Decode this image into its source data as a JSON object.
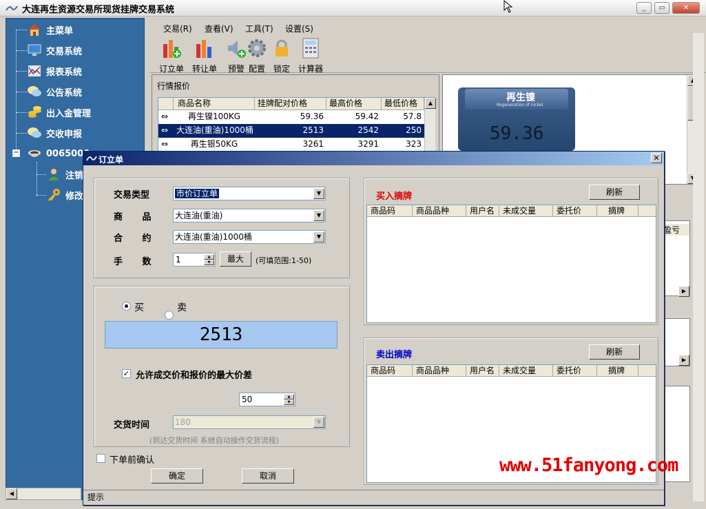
{
  "window": {
    "title": "大连再生资源交易所现货挂牌交易系统"
  },
  "sidebar": {
    "items": [
      {
        "label": "主菜单",
        "icon": "home-icon"
      },
      {
        "label": "交易系统",
        "icon": "monitor-icon"
      },
      {
        "label": "报表系统",
        "icon": "chart-report-icon"
      },
      {
        "label": "公告系统",
        "icon": "speech-bubble-icon"
      },
      {
        "label": "出入金管理",
        "icon": "coins-icon"
      },
      {
        "label": "交收申报",
        "icon": "speech-bubble-icon"
      },
      {
        "label": "0065000",
        "icon": "coffee-cup-icon"
      },
      {
        "label": "注销",
        "icon": "user-icon"
      },
      {
        "label": "修改",
        "icon": "key-icon"
      }
    ]
  },
  "menubar": [
    "交易(R)",
    "查看(V)",
    "工具(T)",
    "设置(S)"
  ],
  "toolbar": [
    "订立单",
    "转让单",
    "预警",
    "配置",
    "锁定",
    "计算器"
  ],
  "quotes": {
    "title": "行情报价",
    "columns": [
      "商品名称",
      "挂牌配对价格",
      "最高价格",
      "最低价格"
    ],
    "rows": [
      {
        "name": "再生镍100KG",
        "price": "59.36",
        "high": "59.42",
        "low": "57.8"
      },
      {
        "name": "大连油(重油)1000桶",
        "price": "2513",
        "high": "2542",
        "low": "250"
      },
      {
        "name": "再生银50KG",
        "price": "3261",
        "high": "3291",
        "low": "323"
      }
    ]
  },
  "preview": {
    "product": "再生镍",
    "subtitle": "Regeneration of nickel",
    "price": "59.36"
  },
  "right_partial": {
    "col_label": "盈亏"
  },
  "dialog": {
    "title": "订立单",
    "trade_type_label": "交易类型",
    "trade_type_value": "市价订立单",
    "product_label": "商 品",
    "product_value": "大连油(重油)",
    "contract_label": "合 约",
    "contract_value": "大连油(重油)1000桶",
    "qty_label": "手 数",
    "qty_value": "1",
    "max_button": "最大",
    "qty_hint": "(可填范围:1-50)",
    "buy_label": "买",
    "sell_label": "卖",
    "price": "2513",
    "allow_diff_label": "允许成交价和报价的最大价差",
    "allow_diff_checked": true,
    "diff_value": "50",
    "delivery_label": "交货时间",
    "delivery_value": "180",
    "delivery_hint": "(到达交货时间 系统自动操作交货流程)",
    "confirm_before_label": "下单前确认",
    "ok_button": "确定",
    "cancel_button": "取消",
    "buy_list": {
      "title": "买入摘牌",
      "refresh": "刷新",
      "columns": [
        "商品码",
        "商品品种",
        "用户名",
        "未成交量",
        "委托价",
        "摘牌"
      ]
    },
    "sell_list": {
      "title": "卖出摘牌",
      "refresh": "刷新",
      "columns": [
        "商品码",
        "商品品种",
        "用户名",
        "未成交量",
        "委托价",
        "摘牌"
      ]
    },
    "status": "提示"
  },
  "watermark": "www.51fanyong.com",
  "colors": {
    "sidebar": "#336a9f",
    "buy_title": "#e00000",
    "sell_title": "#0000c8",
    "selection": "#0a246a",
    "price_box": "#a6c8f0"
  }
}
